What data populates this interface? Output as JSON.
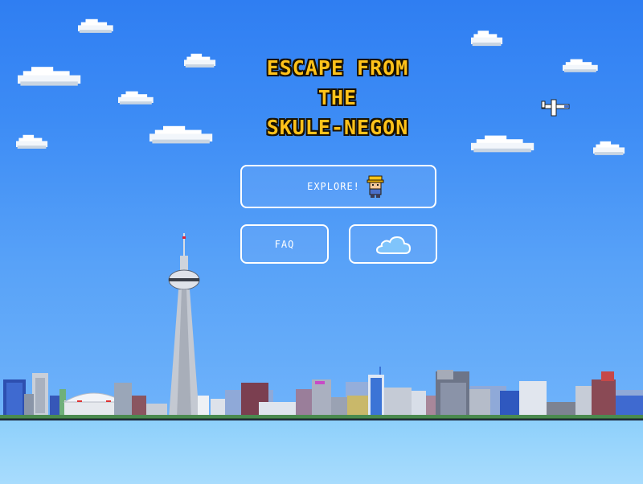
{
  "game": {
    "title_lines": [
      "ESCAPE FROM",
      "THE",
      "SKULE-NEGON"
    ]
  },
  "menu": {
    "explore_label": "EXPLORE!",
    "faq_label": "FAQ",
    "cloud_icon": "cloud-icon",
    "explore_icon": "hardhat-character-icon"
  },
  "colors": {
    "sky_top": "#2f7ef2",
    "sky_bottom": "#6fb3fa",
    "title_fill": "#ffc21a",
    "title_outline": "#1a1200",
    "button_border": "#ffffff",
    "water": "#9ad6fc"
  }
}
